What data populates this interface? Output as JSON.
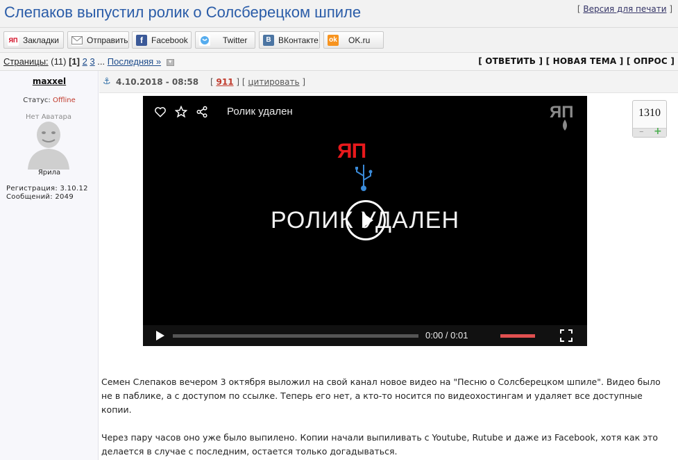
{
  "topic": {
    "title": "Слепаков выпустил ролик о Солсберецком шпиле",
    "print_label": "Версия для печати"
  },
  "share": {
    "buttons": [
      {
        "label": "Закладки",
        "icon": "yap-icon",
        "color": "#d0021b"
      },
      {
        "label": "Отправить",
        "icon": "mail-icon",
        "color": "#888888"
      },
      {
        "label": "Facebook",
        "icon": "facebook-icon",
        "color": "#3b5998"
      },
      {
        "label": "Twitter",
        "icon": "twitter-icon",
        "color": "#55acee"
      },
      {
        "label": "ВКонтакте",
        "icon": "vk-icon",
        "color": "#4c75a3"
      },
      {
        "label": "OK.ru",
        "icon": "ok-icon",
        "color": "#f7931e"
      }
    ]
  },
  "pagination": {
    "label": "Страницы:",
    "count": "(11)",
    "current": "[1]",
    "pages": [
      "2",
      "3"
    ],
    "ellipsis": "...",
    "last": "Последняя »"
  },
  "actions": {
    "reply": "[ ОТВЕТИТЬ ]",
    "new_topic": "[ НОВАЯ ТЕМА ]",
    "poll": "[ ОПРОС ]"
  },
  "author": {
    "username": "maxxel",
    "status_label": "Статус:",
    "status_value": "Offline",
    "no_avatar": "Нет Аватара",
    "rank": "Ярила",
    "registration": "Регистрация: 3.10.12",
    "messages": "Сообщений: 2049"
  },
  "post": {
    "date": "4.10.2018 - 08:58",
    "number": "911",
    "cite": "цитировать",
    "rating": "1310"
  },
  "video": {
    "title": "Ролик удален",
    "big_text": "РОЛИК УДАЛЕН",
    "logo_text": "ЯП",
    "time": "0:00 / 0:01"
  },
  "body": {
    "paragraphs": [
      "Семен Слепаков вечером 3 октября выложил на свой канал новое видео на \"Песню о Солсберецком шпиле\". Видео было не в паблике, а с доступом по ссылке. Теперь его нет, а кто-то носится по видеохостингам и удаляет все доступные копии.",
      "Через пару часов оно уже было выпилено. Копии начали выпиливать с Youtube, Rutube и даже из Facebook, хотя как это делается в случае с последним, остается только догадываться."
    ]
  }
}
